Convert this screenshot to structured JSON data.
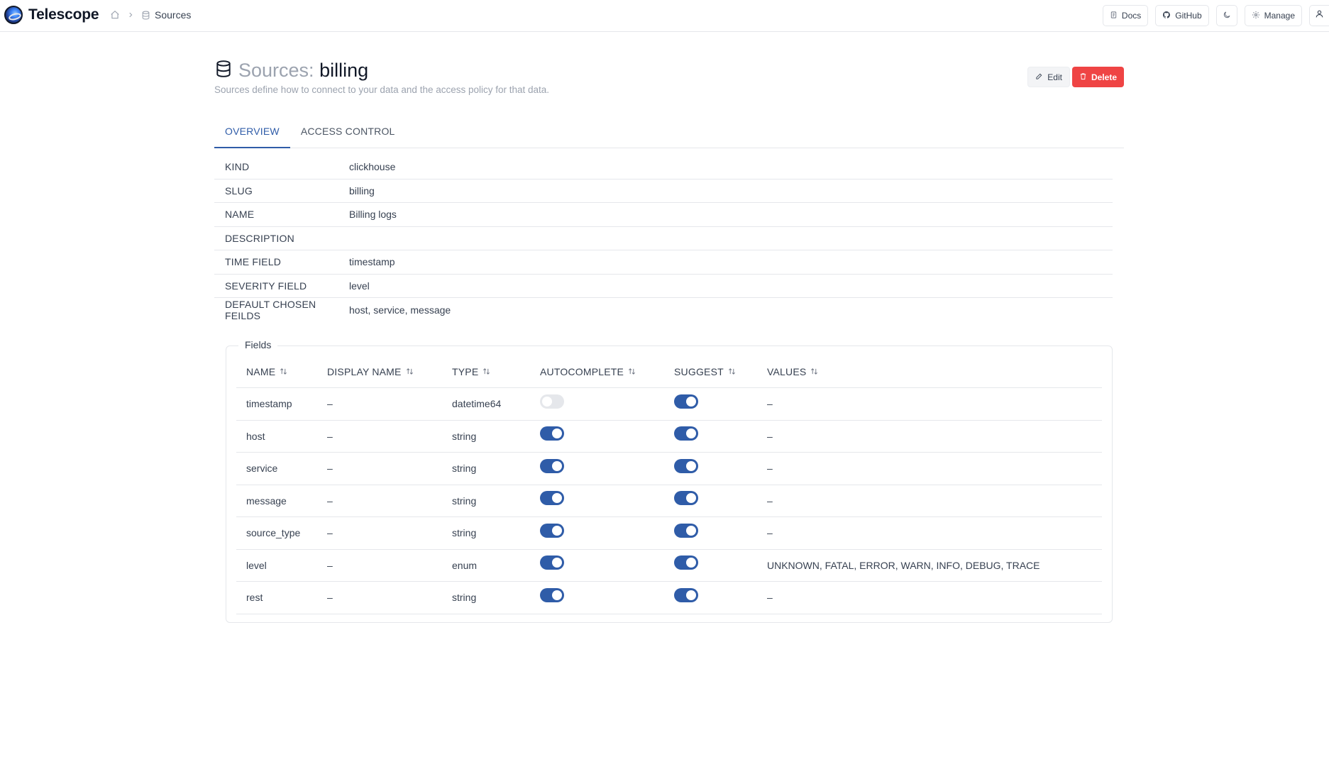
{
  "app": {
    "name": "Telescope"
  },
  "breadcrumb": {
    "current": "Sources"
  },
  "topbar": {
    "docs": "Docs",
    "github": "GitHub",
    "manage": "Manage"
  },
  "header": {
    "prefix": "Sources:",
    "name": "billing",
    "subtitle": "Sources define how to connect to your data and the access policy for that data.",
    "edit": "Edit",
    "delete": "Delete"
  },
  "tabs": [
    {
      "label": "OVERVIEW",
      "active": true
    },
    {
      "label": "ACCESS CONTROL",
      "active": false
    }
  ],
  "details": [
    {
      "label": "KIND",
      "value": "clickhouse"
    },
    {
      "label": "SLUG",
      "value": "billing"
    },
    {
      "label": "NAME",
      "value": "Billing logs"
    },
    {
      "label": "DESCRIPTION",
      "value": ""
    },
    {
      "label": "TIME FIELD",
      "value": "timestamp"
    },
    {
      "label": "SEVERITY FIELD",
      "value": "level"
    },
    {
      "label": "DEFAULT CHOSEN FEILDS",
      "value": "host, service, message"
    }
  ],
  "fields": {
    "legend": "Fields",
    "columns": [
      "NAME",
      "DISPLAY NAME",
      "TYPE",
      "AUTOCOMPLETE",
      "SUGGEST",
      "VALUES"
    ],
    "rows": [
      {
        "name": "timestamp",
        "display_name": "–",
        "type": "datetime64",
        "autocomplete": false,
        "suggest": true,
        "values": "–"
      },
      {
        "name": "host",
        "display_name": "–",
        "type": "string",
        "autocomplete": true,
        "suggest": true,
        "values": "–"
      },
      {
        "name": "service",
        "display_name": "–",
        "type": "string",
        "autocomplete": true,
        "suggest": true,
        "values": "–"
      },
      {
        "name": "message",
        "display_name": "–",
        "type": "string",
        "autocomplete": true,
        "suggest": true,
        "values": "–"
      },
      {
        "name": "source_type",
        "display_name": "–",
        "type": "string",
        "autocomplete": true,
        "suggest": true,
        "values": "–"
      },
      {
        "name": "level",
        "display_name": "–",
        "type": "enum",
        "autocomplete": true,
        "suggest": true,
        "values": "UNKNOWN, FATAL, ERROR, WARN, INFO, DEBUG, TRACE"
      },
      {
        "name": "rest",
        "display_name": "–",
        "type": "string",
        "autocomplete": true,
        "suggest": true,
        "values": "–"
      }
    ]
  }
}
